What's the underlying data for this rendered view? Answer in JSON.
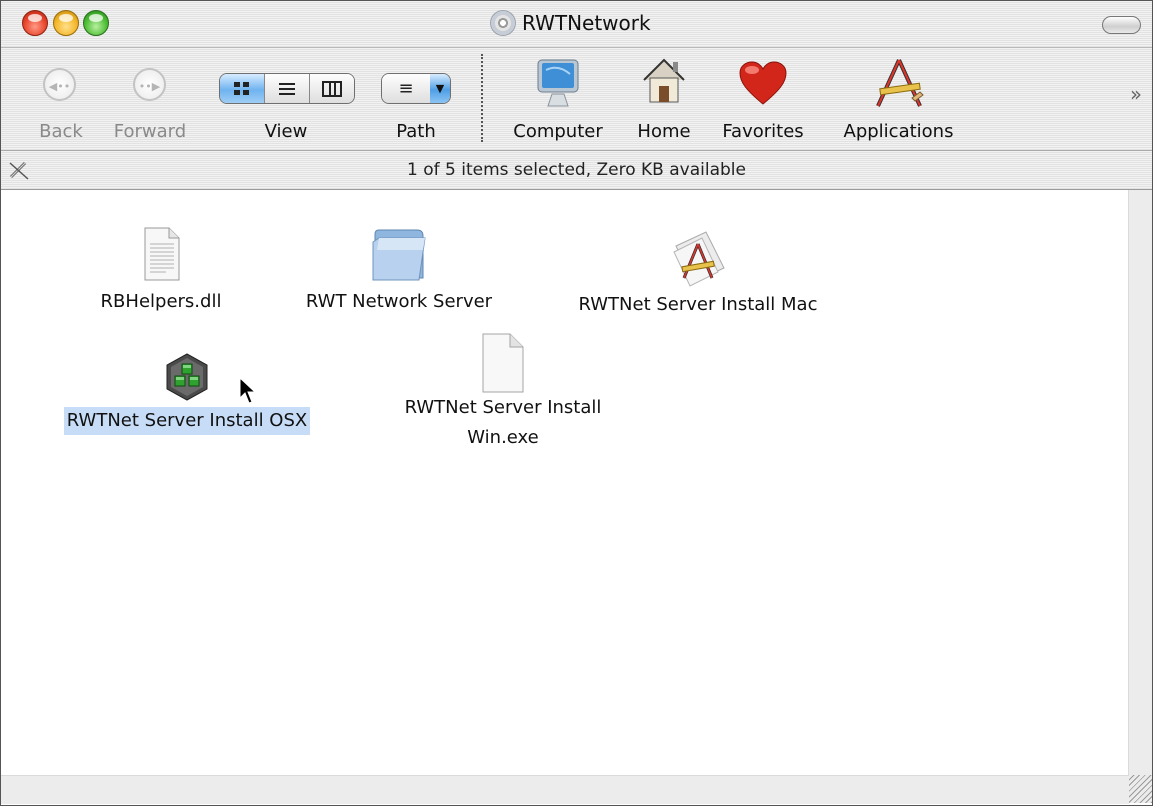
{
  "window": {
    "title": "RWTNetwork"
  },
  "toolbar": {
    "back": "Back",
    "forward": "Forward",
    "view": "View",
    "path": "Path",
    "computer": "Computer",
    "home": "Home",
    "favorites": "Favorites",
    "applications": "Applications",
    "overflow_icon": "chevron-double-right-icon"
  },
  "status": {
    "text": "1 of 5 items selected, Zero KB available"
  },
  "files": [
    {
      "name": "RBHelpers.dll",
      "icon": "document-icon",
      "selected": false
    },
    {
      "name": "RWT Network Server",
      "icon": "folder-icon",
      "selected": false
    },
    {
      "name": "RWTNet Server Install Mac",
      "icon": "application-icon",
      "selected": false
    },
    {
      "name": "RWTNet Server Install OSX",
      "icon": "installer-icon",
      "selected": true
    },
    {
      "name_line1": "RWTNet Server Install",
      "name_line2": "Win.exe",
      "icon": "blank-file-icon",
      "selected": false
    }
  ],
  "colors": {
    "selection": "#c7dcf6",
    "accent": "#4f9fe6"
  }
}
